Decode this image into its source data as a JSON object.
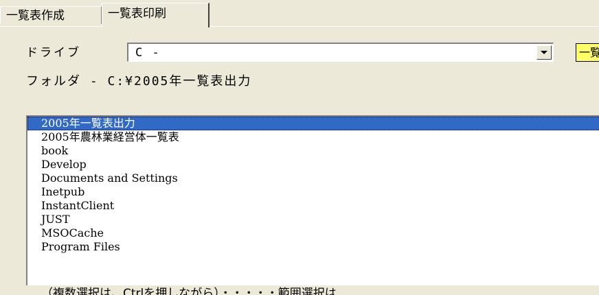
{
  "tabs": {
    "tab1": "一覧表作成",
    "tab2": "一覧表印刷"
  },
  "drive": {
    "label": "ドライブ",
    "value": "C -"
  },
  "yellow_button": "一覧",
  "folder": {
    "label": "フォルダ - C:¥2005年一覧表出力"
  },
  "list": {
    "items": [
      "2005年一覧表出力",
      "2005年農林業経営体一覧表",
      "book",
      "Develop",
      "Documents and Settings",
      "Inetpub",
      "InstantClient",
      "JUST",
      "MSOCache",
      "Program Files"
    ],
    "selected_index": 0
  },
  "footer": {
    "text": "（複数選択は、Ctrlを押しながら）・・・・・範囲選択は"
  }
}
